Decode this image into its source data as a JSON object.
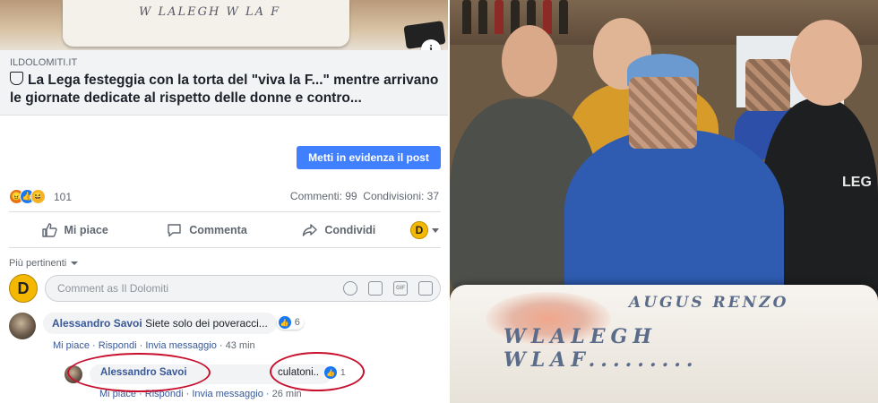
{
  "post": {
    "domain": "ILDOLOMITI.IT",
    "title": "La Lega festeggia con la torta del \"viva la F...\" mentre arrivano le giornate dedicate al rispetto delle donne e contro...",
    "info_glyph": "i",
    "boost_label": "Metti in evidenza il post",
    "reaction_count": "101",
    "comments_count": "Commenti: 99",
    "shares_count": "Condivisioni: 37"
  },
  "thumb_cake_text": "W LALEGH  W LA F",
  "actions": {
    "like": "Mi piace",
    "comment": "Commenta",
    "share": "Condividi",
    "page_avatar_letter": "D"
  },
  "comments_section": {
    "sort_label": "Più pertinenti",
    "composer_placeholder": "Comment as Il Dolomiti",
    "composer_avatar_letter": "D",
    "gif_label": "GIF"
  },
  "comments": [
    {
      "author": "Alessandro Savoi",
      "text": "Siete solo dei poveracci...",
      "likes": "6",
      "like_label": "Mi piace",
      "reply_label": "Rispondi",
      "message_label": "Invia messaggio",
      "time": "43 min"
    },
    {
      "author": "Alessandro Savoi",
      "text": "culatoni..",
      "likes": "1",
      "like_label": "Mi piace",
      "reply_label": "Rispondi",
      "message_label": "Invia messaggio",
      "time": "26 min"
    }
  ],
  "photo": {
    "cake_text_line1": "AUGUS RENZO",
    "cake_text_line2": "WLALEGH",
    "cake_text_line3": "WLAF.........",
    "shirt_text": "LEG"
  },
  "colors": {
    "facebook_blue": "#4080ff",
    "link_blue": "#385898",
    "highlight_red": "#c8102e",
    "page_avatar": "#f5b800"
  }
}
